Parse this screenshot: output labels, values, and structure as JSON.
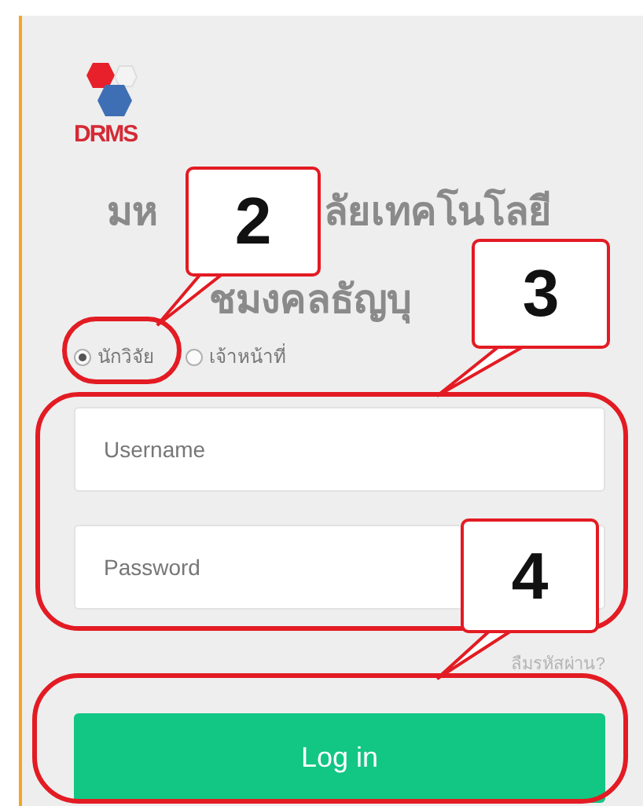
{
  "logo": {
    "text": "DRMS"
  },
  "title": {
    "lines": [
      {
        "parts": [
          "มห",
          "ลัยเทคโนโลยี"
        ]
      },
      {
        "parts": [
          "ชมงคลธัญบุ"
        ]
      }
    ]
  },
  "user_types": [
    {
      "label": "นักวิจัย",
      "selected": true
    },
    {
      "label": "เจ้าหน้าที่",
      "selected": false
    }
  ],
  "fields": [
    {
      "placeholder": "Username"
    },
    {
      "placeholder": "Password"
    }
  ],
  "forgot_link": "ลืมรหัสผ่าน?",
  "login_button": "Log in",
  "annotations": [
    {
      "label": "2"
    },
    {
      "label": "3"
    },
    {
      "label": "4"
    }
  ]
}
